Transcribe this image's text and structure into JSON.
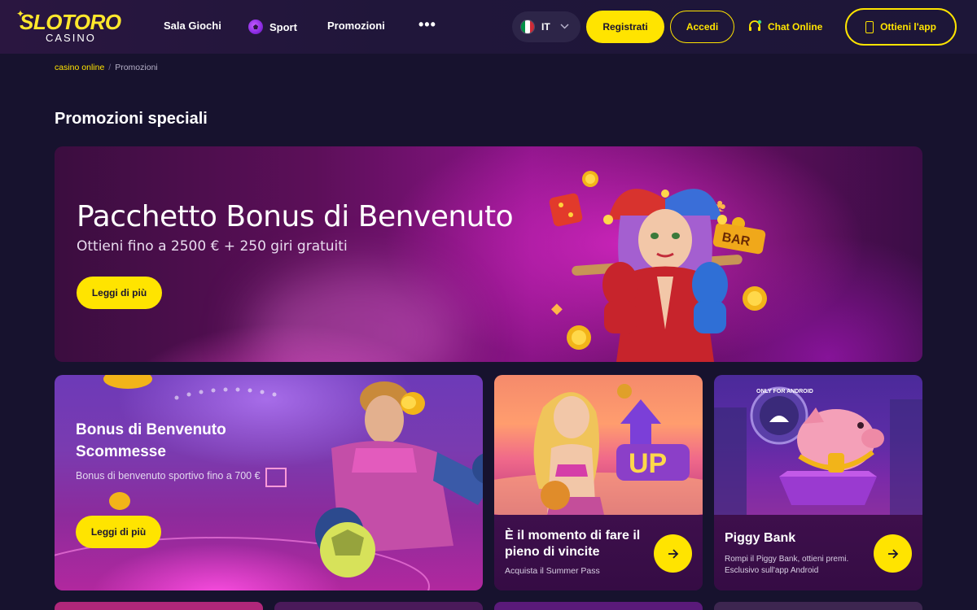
{
  "header": {
    "logo_text": "SLOTORO",
    "logo_sub": "CASINO",
    "nav": {
      "games": "Sala Giochi",
      "sport": "Sport",
      "promotions": "Promozioni",
      "more": "•••"
    },
    "language": {
      "code": "IT"
    },
    "register_label": "Registrati",
    "login_label": "Accedi",
    "chat_label": "Chat Online",
    "app_label": "Ottieni l'app"
  },
  "breadcrumb": {
    "home": "casino online",
    "separator": "/",
    "current": "Promozioni"
  },
  "page_title": "Promozioni speciali",
  "hero": {
    "title": "Pacchetto Bonus di Benvenuto",
    "subtitle": "Ottieni fino a 2500 € + 250 giri gratuiti",
    "button_label": "Leggi di più",
    "badge_text": "BAR"
  },
  "cards": {
    "sport": {
      "title": "Bonus di Benvenuto Scommesse",
      "subtitle": "Bonus di benvenuto sportivo fino a 700 €",
      "button_label": "Leggi di più"
    },
    "summer": {
      "title": "È il momento di fare il pieno di vincite",
      "subtitle": "Acquista il Summer Pass",
      "art_text": "UP"
    },
    "piggy": {
      "title": "Piggy Bank",
      "subtitle": "Rompi il Piggy Bank, ottieni premi. Esclusivo sull'app Android",
      "badge_text": "ONLY FOR ANDROID"
    }
  },
  "colors": {
    "accent": "#ffe400",
    "background": "#17122e",
    "header": "#20163a"
  }
}
